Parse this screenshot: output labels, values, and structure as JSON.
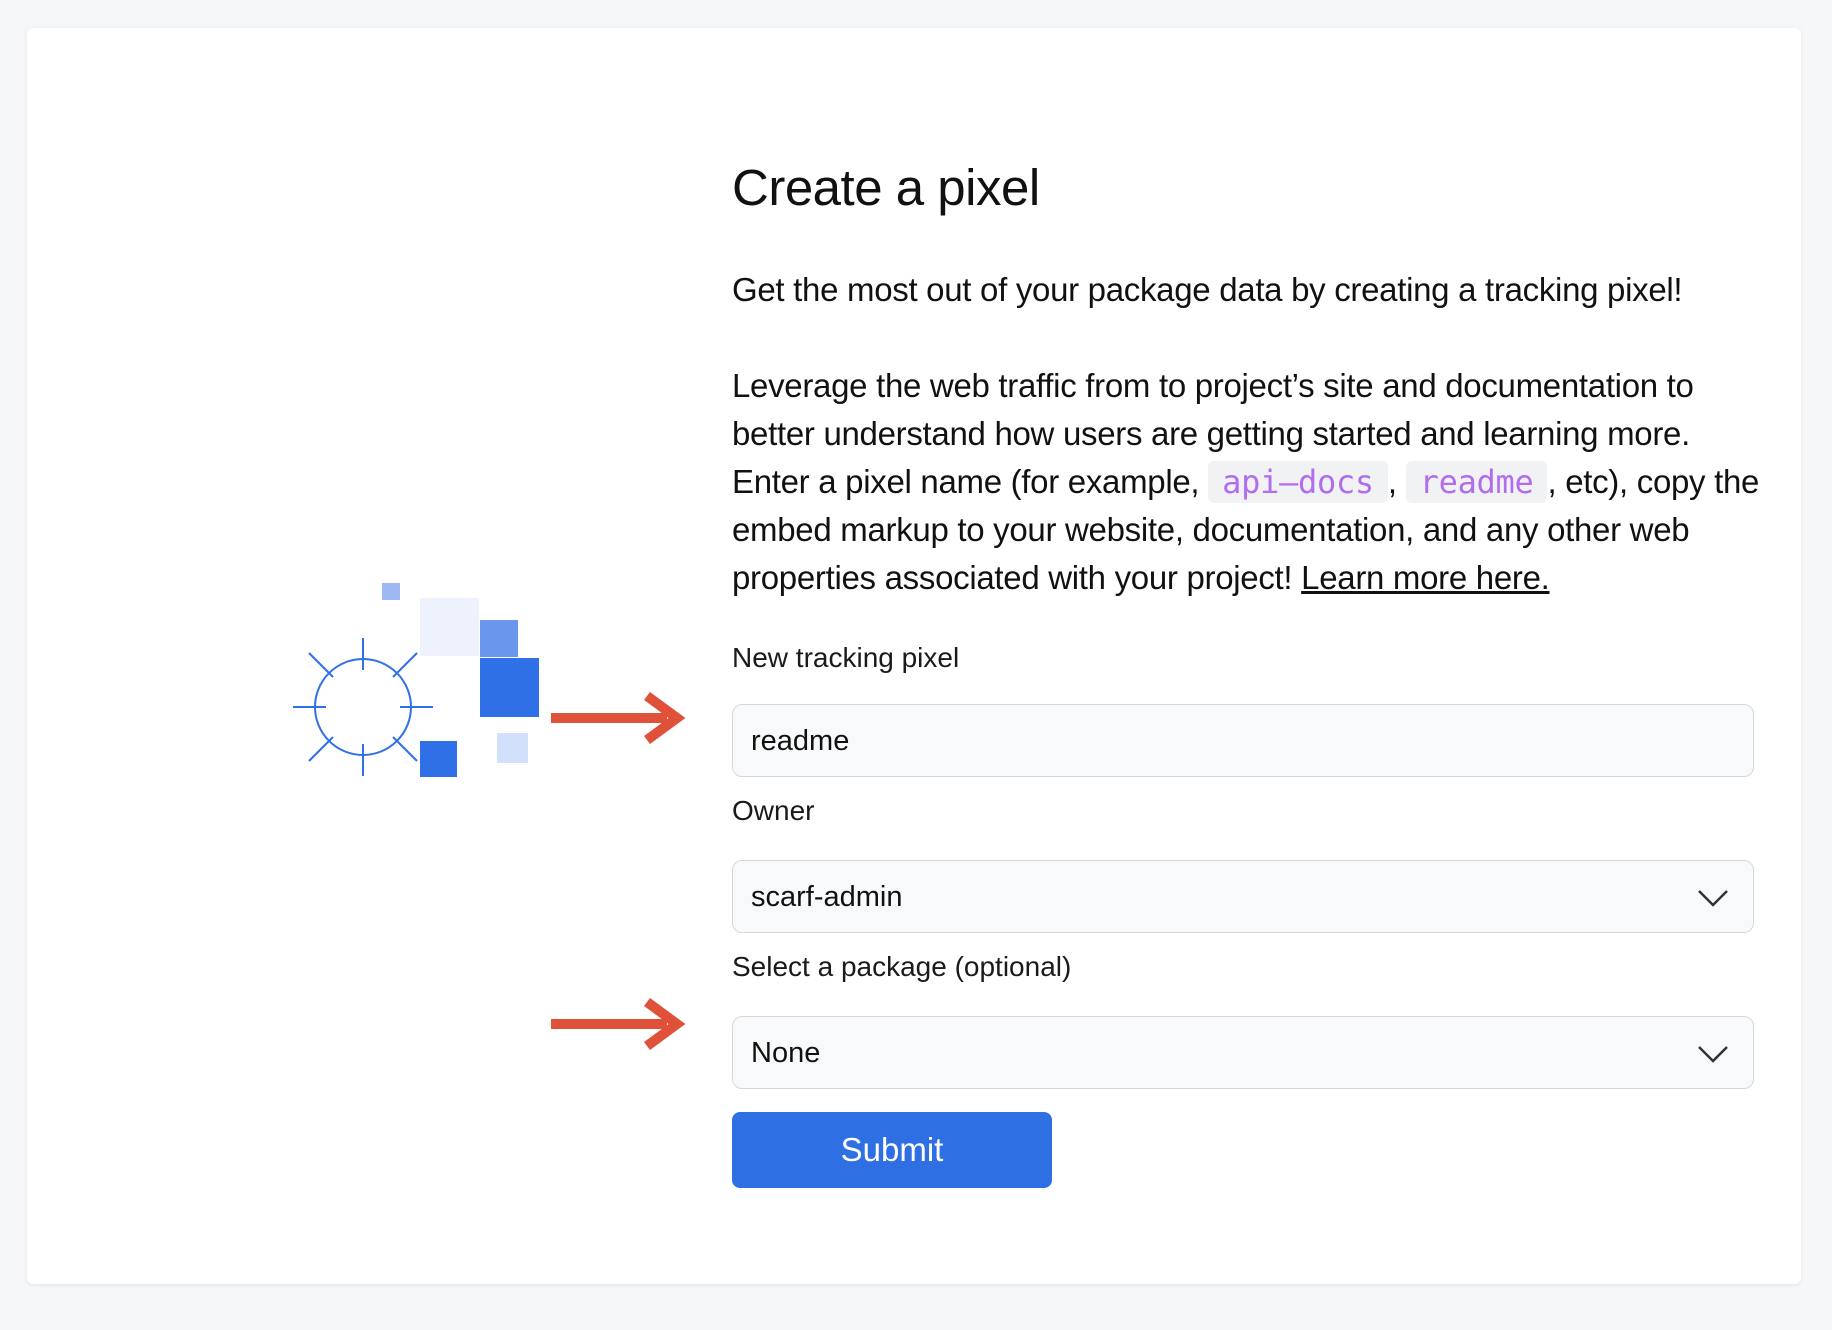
{
  "page": {
    "title": "Create a pixel",
    "intro": "Get the most out of your package data by creating a tracking pixel!",
    "description": {
      "part1": "Leverage the web traffic from to project’s site and documentation to better understand how users are getting started and learning more. Enter a pixel name (for example, ",
      "example1": "api–docs",
      "sep": ", ",
      "example2": "readme",
      "part2": ", etc), copy the embed markup to your website, documentation, and any other web properties associated with your project! ",
      "link": "Learn more here."
    }
  },
  "form": {
    "pixel_label": "New tracking pixel",
    "pixel_value": "readme",
    "owner_label": "Owner",
    "owner_value": "scarf-admin",
    "package_label": "Select a package (optional)",
    "package_value": "None",
    "submit_label": "Submit"
  },
  "colors": {
    "accent": "#2f6fe4",
    "annotation_arrow": "#e0513a",
    "code_text": "#b26cf0"
  },
  "icons": {
    "illustration": "pixel-illustration",
    "arrows": "annotation-arrow-icon",
    "dropdown": "chevron-down-icon"
  }
}
